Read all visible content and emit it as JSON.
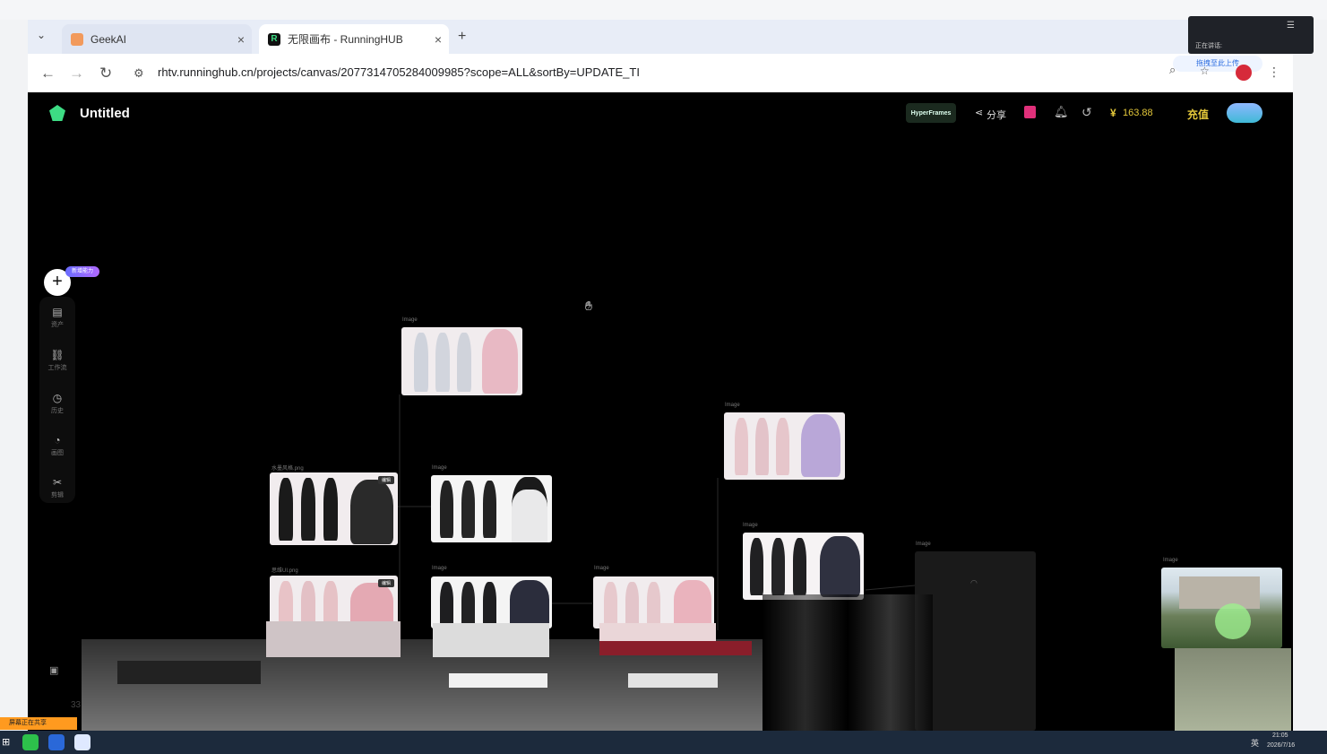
{
  "browser": {
    "tabs": [
      {
        "title": "GeekAI",
        "active": false
      },
      {
        "title": "无限画布 - RunningHUB",
        "active": true
      }
    ],
    "new_tab_label": "+",
    "url": "rhtv.runninghub.cn/projects/canvas/2077314705284009985?scope=ALL&sortBy=UPDATE_TI"
  },
  "app": {
    "title": "Untitled",
    "hyperframes_label": "HyperFrames",
    "share_label": "分享",
    "balance": "163.88",
    "currency_symbol": "¥",
    "recharge_label": "充值",
    "new_badge": "新增能力"
  },
  "sidebar": {
    "items": [
      {
        "label": "资产",
        "icon": "archive-icon"
      },
      {
        "label": "工作流",
        "icon": "workflow-icon"
      },
      {
        "label": "历史",
        "icon": "history-icon"
      },
      {
        "label": "画图",
        "icon": "palette-icon"
      },
      {
        "label": "剪辑",
        "icon": "scissors-icon"
      }
    ]
  },
  "nodes": [
    {
      "title": "Image"
    },
    {
      "title": "Image"
    },
    {
      "title": "水墨风格.png",
      "badge": "编辑"
    },
    {
      "title": "Image"
    },
    {
      "title": "Image"
    },
    {
      "title": "思维UI.png",
      "badge": "编辑"
    },
    {
      "title": "Image"
    },
    {
      "title": "Image"
    },
    {
      "title": "Image"
    },
    {
      "title": "Image"
    }
  ],
  "footer": {
    "sharing_label": "屏幕正在共享",
    "count": "33",
    "clock_time": "21:05",
    "clock_date": "2026/7/16",
    "lang": "英"
  },
  "overlay": {
    "meeting_status": "正在讲话:",
    "upload_label": "拖拽至此上传"
  },
  "colors": {
    "accent_green": "#3ddc84",
    "balance_yellow": "#e3c73a",
    "app_bg": "#000000"
  }
}
